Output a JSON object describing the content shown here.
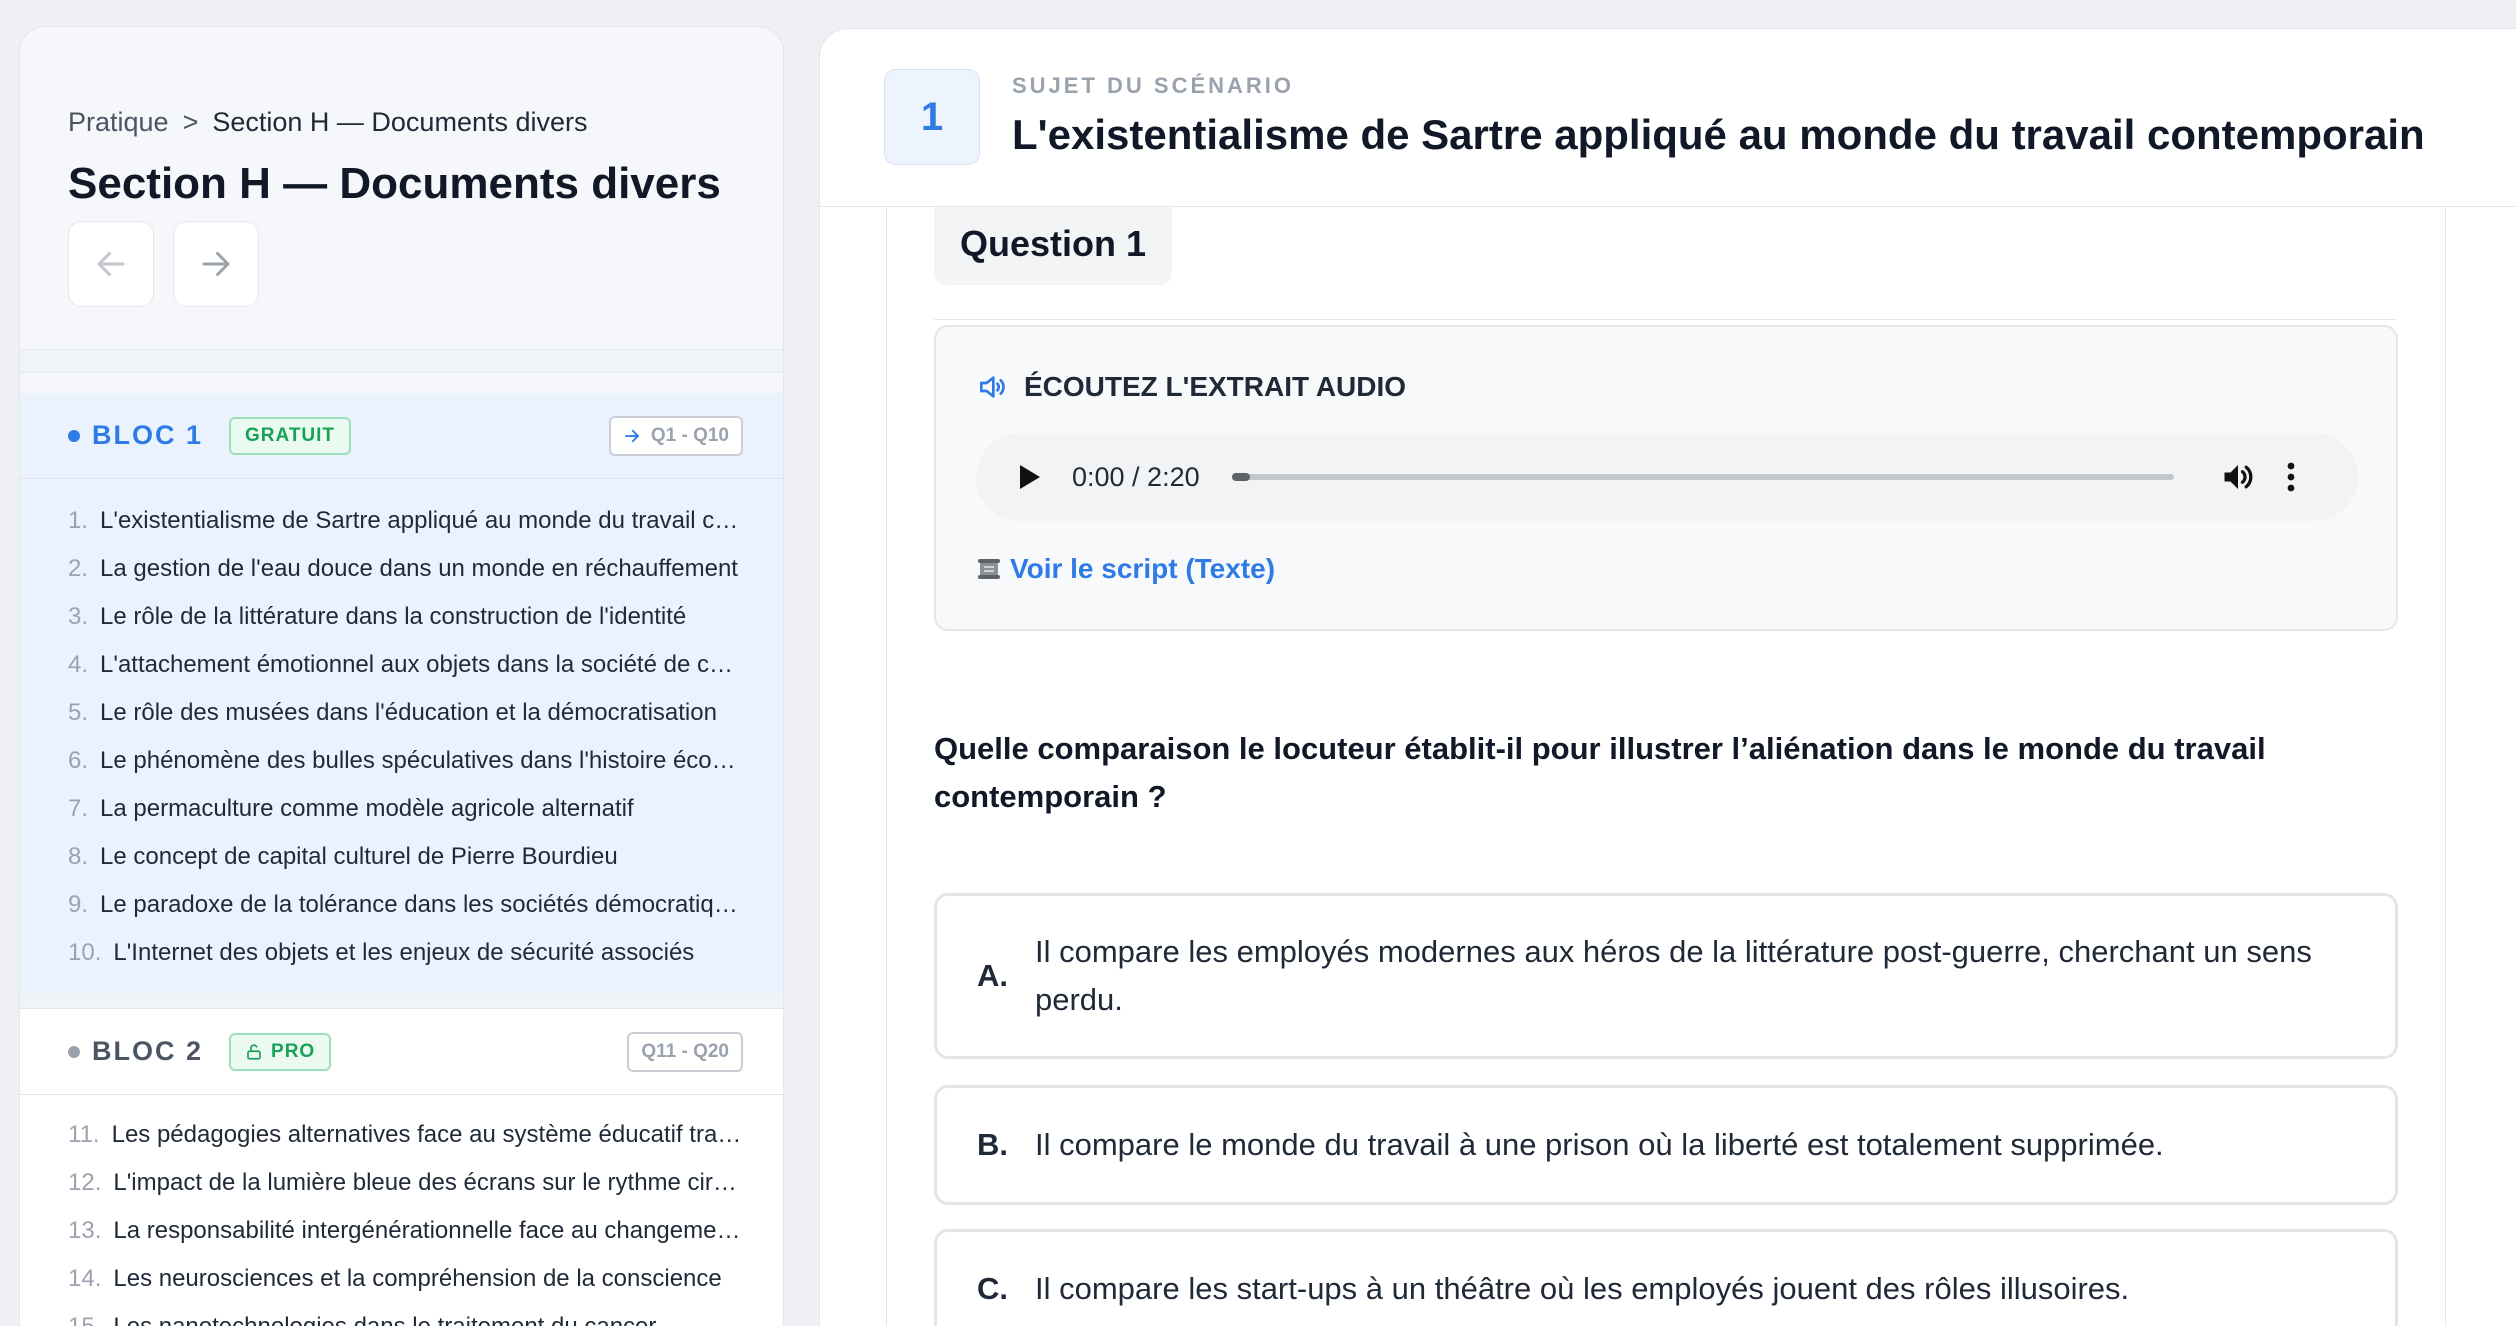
{
  "sidebar": {
    "breadcrumb": {
      "root": "Pratique",
      "separator": ">",
      "current": "Section H — Documents divers"
    },
    "title": "Section H — Documents divers",
    "nav": {
      "prev_icon": "arrow-left-icon",
      "next_icon": "arrow-right-icon"
    },
    "blocs": [
      {
        "name": "BLOC 1",
        "badge": "GRATUIT",
        "range": "Q1 - Q10",
        "range_icon": "arrow-right-icon",
        "active": true,
        "items": [
          {
            "num": "1.",
            "title": "L'existentialisme de Sartre appliqué au monde du travail contemporain"
          },
          {
            "num": "2.",
            "title": "La gestion de l'eau douce dans un monde en réchauffement"
          },
          {
            "num": "3.",
            "title": "Le rôle de la littérature dans la construction de l'identité"
          },
          {
            "num": "4.",
            "title": "L'attachement émotionnel aux objets dans la société de consommation"
          },
          {
            "num": "5.",
            "title": "Le rôle des musées dans l'éducation et la démocratisation"
          },
          {
            "num": "6.",
            "title": "Le phénomène des bulles spéculatives dans l'histoire économique"
          },
          {
            "num": "7.",
            "title": "La permaculture comme modèle agricole alternatif"
          },
          {
            "num": "8.",
            "title": "Le concept de capital culturel de Pierre Bourdieu"
          },
          {
            "num": "9.",
            "title": "Le paradoxe de la tolérance dans les sociétés démocratiques"
          },
          {
            "num": "10.",
            "title": "L'Internet des objets et les enjeux de sécurité associés"
          }
        ]
      },
      {
        "name": "BLOC 2",
        "badge": "PRO",
        "badge_icon": "lock-icon",
        "range": "Q11 - Q20",
        "active": false,
        "items": [
          {
            "num": "11.",
            "title": "Les pédagogies alternatives face au système éducatif traditionnel"
          },
          {
            "num": "12.",
            "title": "L'impact de la lumière bleue des écrans sur le rythme circadien"
          },
          {
            "num": "13.",
            "title": "La responsabilité intergénérationnelle face au changement climatique"
          },
          {
            "num": "14.",
            "title": "Les neurosciences et la compréhension de la conscience"
          },
          {
            "num": "15.",
            "title": "Les nanotechnologies dans le traitement du cancer"
          }
        ]
      }
    ]
  },
  "scenario": {
    "number": "1",
    "label": "SUJET DU SCÉNARIO",
    "title": "L'existentialisme de Sartre appliqué au monde du travail contemporain"
  },
  "question": {
    "label": "Question 1",
    "audio": {
      "title": "ÉCOUTEZ L'EXTRAIT AUDIO",
      "icon": "speaker-icon",
      "time": "0:00 / 2:20",
      "progress": 0.02,
      "script_link": "Voir le script (Texte)",
      "script_icon": "scroll-icon"
    },
    "prompt": "Quelle comparaison le locuteur établit-il pour illustrer l’aliénation dans le monde du travail contemporain ?",
    "choices": [
      {
        "letter": "A.",
        "text": "Il compare les employés modernes aux héros de la littérature post-guerre, cherchant un sens perdu."
      },
      {
        "letter": "B.",
        "text": "Il compare le monde du travail à une prison où la liberté est totalement supprimée."
      },
      {
        "letter": "C.",
        "text": "Il compare les start-ups à un théâtre où les employés jouent des rôles illusoires."
      }
    ]
  },
  "colors": {
    "accent": "#2f7be5",
    "free_badge": "#1aa158",
    "active_bloc_bg": "#eaf2fd"
  }
}
